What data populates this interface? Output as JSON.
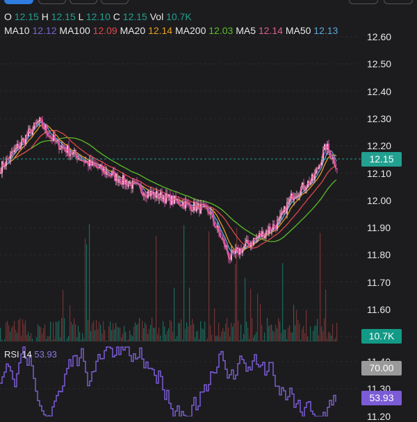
{
  "ohlc": {
    "o_label": "O",
    "o": "12.15",
    "h_label": "H",
    "h": "12.15",
    "l_label": "L",
    "l": "12.10",
    "c_label": "C",
    "c": "12.15",
    "vol_label": "Vol",
    "vol": "10.7K"
  },
  "ma": [
    {
      "label": "MA10",
      "value": "12.12",
      "color": "#7a66c9"
    },
    {
      "label": "MA100",
      "value": "12.09",
      "color": "#e0484b"
    },
    {
      "label": "MA20",
      "value": "12.14",
      "color": "#e8a020"
    },
    {
      "label": "MA200",
      "value": "12.03",
      "color": "#5cbf2a"
    },
    {
      "label": "MA5",
      "value": "12.14",
      "color": "#e0608a"
    },
    {
      "label": "MA50",
      "value": "12.13",
      "color": "#5fa8d8"
    }
  ],
  "axis": [
    "12.60",
    "12.50",
    "12.40",
    "12.30",
    "12.20",
    "12.10",
    "12.00",
    "11.90",
    "11.80",
    "11.70",
    "11.60",
    "11.40",
    "11.30",
    "11.20"
  ],
  "last_price": "12.15",
  "volume_tag": "10.7K",
  "rsi": {
    "label": "RSI 14",
    "value": "53.93",
    "level": "70.00"
  },
  "price_keypoints": [
    [
      0,
      12.12
    ],
    [
      55,
      12.29
    ],
    [
      80,
      12.21
    ],
    [
      130,
      12.13
    ],
    [
      210,
      12.03
    ],
    [
      300,
      11.96
    ],
    [
      330,
      11.79
    ],
    [
      350,
      11.83
    ],
    [
      400,
      11.92
    ],
    [
      420,
      12.02
    ],
    [
      450,
      12.08
    ],
    [
      468,
      12.2
    ],
    [
      485,
      12.12
    ]
  ],
  "colors": {
    "teal": "#22a090",
    "rsi": "#7b5cd6",
    "level": "#8e8e8e"
  }
}
